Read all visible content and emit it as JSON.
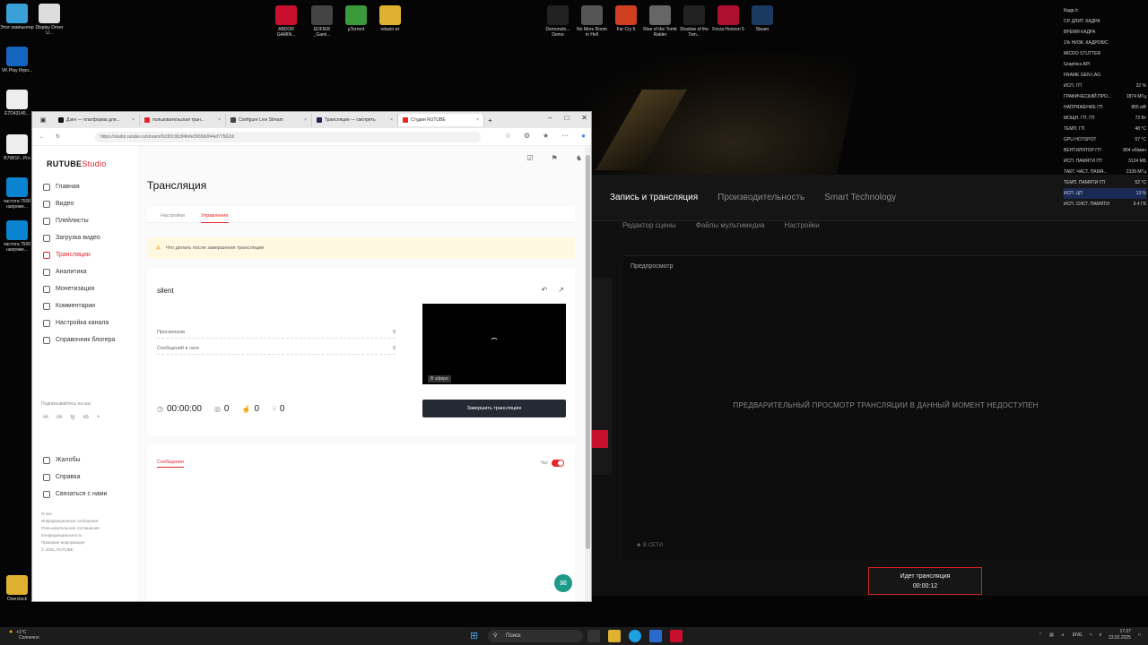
{
  "desktop": {
    "top_icons": [
      {
        "label": "ABDOR GAMIN...",
        "color": "#c8102e"
      },
      {
        "label": "EDFIER _Gami...",
        "color": "#444"
      },
      {
        "label": "µTorrent",
        "color": "#3a9a3a"
      },
      {
        "label": "relaxin ат",
        "color": "#e0b030"
      },
      {
        "label": "Demonolo... Demo",
        "color": "#222"
      },
      {
        "label": "No More Room in Hell",
        "color": "#555"
      },
      {
        "label": "Far Cry 6",
        "color": "#d04020"
      },
      {
        "label": "Rise of the Tomb Raider",
        "color": "#666"
      },
      {
        "label": "Shadow of the Tom...",
        "color": "#222"
      },
      {
        "label": "Forza Horizon 5",
        "color": "#b01030"
      },
      {
        "label": "Steam",
        "color": "#1b3a60"
      }
    ],
    "left_icons": [
      {
        "label": "Этот компьютер",
        "color": "#3aa0d8"
      },
      {
        "label": "Display Driver U...",
        "color": "#ddd"
      },
      {
        "label": "VK Play Игро...",
        "color": "#1565c0"
      },
      {
        "label": "E7D43145...",
        "color": "#eee"
      },
      {
        "label": "B76B1F...Pro",
        "color": "#eee"
      },
      {
        "label": "частота 7500 напряже...",
        "color": "#0a84d0"
      },
      {
        "label": "частота 7500 напряже...",
        "color": "#0a84d0"
      },
      {
        "label": "Overclock",
        "color": "#e0b030"
      }
    ]
  },
  "hud": {
    "rows": [
      {
        "k": "Кадр./с",
        "v": ""
      },
      {
        "k": "СР. ДЛИТ. КАДРА",
        "v": ""
      },
      {
        "k": "ВРЕМЯ КАДРА",
        "v": ""
      },
      {
        "k": "1% НИЗК. КАДРОВ/С",
        "v": ""
      },
      {
        "k": "MICRO STUTTER",
        "v": ""
      },
      {
        "k": "Graphics API",
        "v": ""
      },
      {
        "k": "FRAME GEN LAG",
        "v": ""
      },
      {
        "k": "ИСП. ГП",
        "v": "22 %"
      },
      {
        "k": "ГРАФИЧЕСКИЙ ПРО...",
        "v": "1874 МГц"
      },
      {
        "k": "НАПРЯЖЕНИЕ ГП",
        "v": "855 мВ"
      },
      {
        "k": "МОЩН. ГП. ГП",
        "v": "72 Вт"
      },
      {
        "k": "ТЕМП. ГП",
        "v": "48 °C"
      },
      {
        "k": "GPU HOTSPOT",
        "v": "57 °C"
      },
      {
        "k": "ВЕНТИЛЯТОР ГП",
        "v": "804 об/мин"
      },
      {
        "k": "ИСП. ПАМЯТИ ГП",
        "v": "3124 МБ"
      },
      {
        "k": "ТАКТ. ЧАСТ. ПАМЯ...",
        "v": "2338 МГц"
      },
      {
        "k": "ТЕМП. ПАМЯТИ ГП",
        "v": "52 °C"
      },
      {
        "k": "ИСП. ЦП",
        "v": "13 %"
      },
      {
        "k": "ИСП. СИСТ. ПАМЯТИ",
        "v": "9.4 ГБ"
      }
    ]
  },
  "gameapp": {
    "tabs": [
      "Запись и трансляция",
      "Производительность",
      "Smart Technology"
    ],
    "subtabs": [
      "Редактор сцены",
      "Файлы мультимедиа",
      "Настройки"
    ],
    "preview_label": "Предпросмотр",
    "preview_msg": "ПРЕДВАРИТЕЛЬНЫЙ ПРОСМОТР ТРАНСЛЯЦИИ В ДАННЫЙ МОМЕНТ НЕДОСТУПЕН",
    "net_status": "В СЕТИ",
    "rec_title": "Идет трансляция",
    "rec_time": "00:00:12"
  },
  "browser": {
    "tabs": [
      {
        "label": "Дзен — платформа для...",
        "color": "#111"
      },
      {
        "label": "пользовательская тран...",
        "color": "#e5252a"
      },
      {
        "label": "Configure Live Stream",
        "color": "#444"
      },
      {
        "label": "Трансляция — смотреть",
        "color": "#1b2b4d"
      },
      {
        "label": "Студия RUTUBE",
        "color": "#e5252a"
      }
    ],
    "url": "https://studio.rutube.ru/stream/9c0f2c9b3f4fefe3965b0f44ef77562d/"
  },
  "studio": {
    "logo_main": "RUTUBE",
    "logo_sub": "Studio",
    "nav": [
      {
        "label": "Главная",
        "active": false
      },
      {
        "label": "Видео",
        "active": false
      },
      {
        "label": "Плейлисты",
        "active": false
      },
      {
        "label": "Загрузка видео",
        "active": false
      },
      {
        "label": "Трансляции",
        "active": true
      },
      {
        "label": "Аналитика",
        "active": false
      },
      {
        "label": "Монетизация",
        "active": false
      },
      {
        "label": "Комментарии",
        "active": false
      },
      {
        "label": "Настройка канала",
        "active": false
      },
      {
        "label": "Справочник блогера",
        "active": false
      }
    ],
    "subscribe_label": "Подписывайтесь на нас",
    "social": [
      "vk",
      "ok",
      "tg",
      "vb",
      "+"
    ],
    "nav2": [
      "Жалобы",
      "Справка",
      "Связаться с нами"
    ],
    "footer": [
      "О нас",
      "Информационные сообщения",
      "Пользовательское соглашение",
      "Конфиденциальность",
      "Правовая информация",
      "© 2025, RUTUBE"
    ],
    "page_title": "Трансляция",
    "tabs": [
      "Настройки",
      "Управление"
    ],
    "warning": "Что делать после завершения трансляции",
    "stream_name": "silent",
    "stats": [
      {
        "label": "Просмотров",
        "value": "0"
      },
      {
        "label": "Сообщений в чате",
        "value": "0"
      }
    ],
    "live_badge": "В эфире",
    "duration": "00:00:00",
    "viewers": "0",
    "likes": "0",
    "dislikes": "0",
    "end_button": "Завершить трансляцию",
    "chat_tab": "Сообщения",
    "chat_toggle": "Чат"
  },
  "taskbar": {
    "weather_temp": "+1°C",
    "weather_desc": "Солнечно",
    "search": "Поиск",
    "lang": "ENG",
    "time": "17:27",
    "date": "23.02.2025"
  }
}
